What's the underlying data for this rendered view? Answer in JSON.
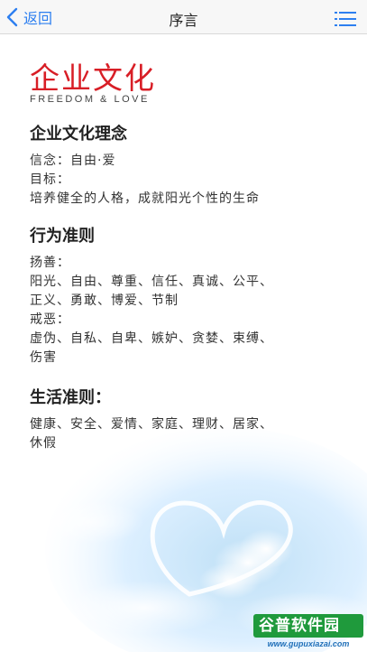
{
  "nav": {
    "back_label": "返回",
    "title": "序言",
    "accent_color": "#2d7ff0"
  },
  "banner": {
    "title": "企业文化",
    "subtitle": "FREEDOM & LOVE",
    "title_color": "#d81e26"
  },
  "sections": [
    {
      "heading": "企业文化理念",
      "lines": [
        "信念：自由·爱",
        "目标：",
        "培养健全的人格，成就阳光个性的生命"
      ]
    },
    {
      "heading": "行为准则",
      "lines": [
        "扬善：",
        "阳光、自由、尊重、信任、真诚、公平、",
        "正义、勇敢、博爱、节制",
        "戒恶：",
        "虚伪、自私、自卑、嫉妒、贪婪、束缚、",
        "伤害"
      ]
    },
    {
      "heading": "生活准则：",
      "lines": [
        "健康、安全、爱情、家庭、理财、居家、",
        "休假"
      ]
    }
  ],
  "watermark": {
    "brand": "谷普软件园",
    "url": "www.gupuxiazai.com"
  },
  "icons": {
    "back": "chevron-left-icon",
    "menu": "list-menu-icon",
    "decoration": "heart-cloud-icon"
  }
}
